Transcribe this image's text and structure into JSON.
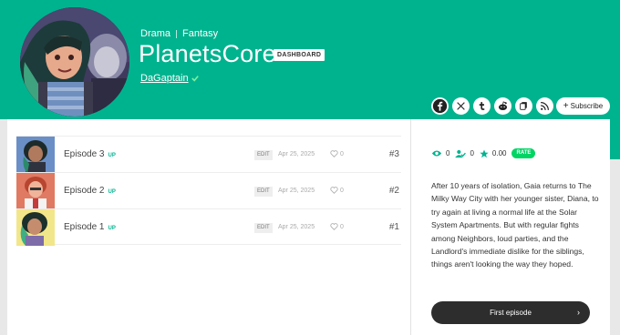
{
  "header": {
    "genres": [
      "Drama",
      "Fantasy"
    ],
    "title": "PlanetsCore",
    "dashboard_badge": "DASHBOARD",
    "author": "DaGaptain",
    "subscribe_label": "Subscribe",
    "social_icons": [
      "facebook-icon",
      "x-icon",
      "tumblr-icon",
      "reddit-icon",
      "copy-link-icon",
      "rss-icon"
    ]
  },
  "episodes": [
    {
      "title": "Episode 3",
      "up": "UP",
      "edit": "EDIT",
      "date": "Apr 25, 2025",
      "likes": "0",
      "number": "#3"
    },
    {
      "title": "Episode 2",
      "up": "UP",
      "edit": "EDIT",
      "date": "Apr 25, 2025",
      "likes": "0",
      "number": "#2"
    },
    {
      "title": "Episode 1",
      "up": "UP",
      "edit": "EDIT",
      "date": "Apr 25, 2025",
      "likes": "0",
      "number": "#1"
    }
  ],
  "stats": {
    "views": "0",
    "subscribers": "0",
    "rating": "0.00",
    "rate_label": "RATE"
  },
  "summary": "After 10 years of isolation, Gaia returns to The Milky Way City with her younger sister, Diana, to try again at living a normal life at the Solar System Apartments. But with regular fights among Neighbors, loud parties, and the Landlord's immediate dislike for the siblings, things aren't looking the way they hoped.",
  "first_episode_label": "First episode",
  "colors": {
    "accent": "#00b38f",
    "rate": "#00d564",
    "button_dark": "#2d2d2d"
  }
}
